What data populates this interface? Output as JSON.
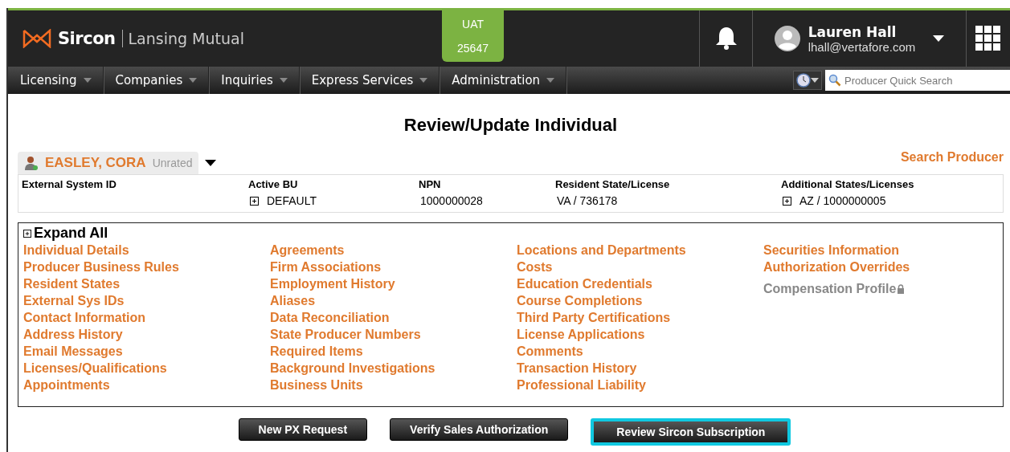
{
  "header": {
    "brand": "Sircon",
    "company": "Lansing Mutual",
    "environment": [
      "UAT",
      "25647"
    ],
    "user": {
      "name": "Lauren Hall",
      "email": "lhall@vertafore.com"
    }
  },
  "nav": {
    "menus": [
      "Licensing",
      "Companies",
      "Inquiries",
      "Express Services",
      "Administration"
    ],
    "search": {
      "placeholder": "Producer Quick Search"
    }
  },
  "page_title": "Review/Update Individual",
  "producer": {
    "name": "EASLEY, CORA",
    "rating": "Unrated"
  },
  "search_producer_link": "Search Producer",
  "summary": {
    "columns": [
      {
        "label": "External System ID",
        "expandable": false
      },
      {
        "label": "Active BU",
        "value": "DEFAULT",
        "expandable": true
      },
      {
        "label": "NPN",
        "value": "1000000028",
        "expandable": false
      },
      {
        "label": "Resident State/License",
        "value": "VA / 736178",
        "expandable": false
      },
      {
        "label": "Additional States/Licenses",
        "value": "AZ / 1000000005",
        "expandable": true
      }
    ]
  },
  "sections": {
    "expand_all": "Expand All",
    "columns": [
      [
        {
          "label": "Individual Details",
          "disabled": false
        },
        {
          "label": "Producer Business Rules",
          "disabled": false
        },
        {
          "label": "Resident States",
          "disabled": false
        },
        {
          "label": "External Sys IDs",
          "disabled": false
        },
        {
          "label": "Contact Information",
          "disabled": false
        },
        {
          "label": "Address History",
          "disabled": false
        },
        {
          "label": "Email Messages",
          "disabled": false
        },
        {
          "label": "Licenses/Qualifications",
          "disabled": false
        },
        {
          "label": "Appointments",
          "disabled": false
        }
      ],
      [
        {
          "label": "Agreements",
          "disabled": false
        },
        {
          "label": "Firm Associations",
          "disabled": false
        },
        {
          "label": "Employment History",
          "disabled": false
        },
        {
          "label": "Aliases",
          "disabled": false
        },
        {
          "label": "Data Reconciliation",
          "disabled": false
        },
        {
          "label": "State Producer Numbers",
          "disabled": false
        },
        {
          "label": "Required Items",
          "disabled": false
        },
        {
          "label": "Background Investigations",
          "disabled": false
        },
        {
          "label": "Business Units",
          "disabled": false
        }
      ],
      [
        {
          "label": "Locations and Departments",
          "disabled": false
        },
        {
          "label": "Costs",
          "disabled": false
        },
        {
          "label": "Education Credentials",
          "disabled": false
        },
        {
          "label": "Course Completions",
          "disabled": false
        },
        {
          "label": "Third Party Certifications",
          "disabled": false
        },
        {
          "label": "License Applications",
          "disabled": false
        },
        {
          "label": "Comments",
          "disabled": false
        },
        {
          "label": "Transaction History",
          "disabled": false
        },
        {
          "label": "Professional Liability",
          "disabled": false
        }
      ],
      [
        {
          "label": "Securities Information",
          "disabled": false
        },
        {
          "label": "Authorization Overrides",
          "disabled": false
        },
        {
          "label": "Compensation Profile",
          "disabled": true
        }
      ]
    ]
  },
  "buttons": [
    {
      "label": "New PX Request",
      "highlighted": false
    },
    {
      "label": "Verify Sales Authorization",
      "highlighted": false
    },
    {
      "label": "Review Sircon Subscription",
      "highlighted": true
    }
  ]
}
